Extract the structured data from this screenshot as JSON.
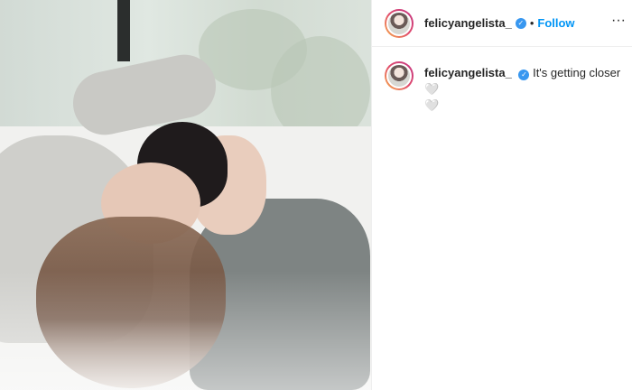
{
  "post": {
    "username": "felicyangelista_",
    "verified_glyph": "✓",
    "separator": "•",
    "follow_label": "Follow",
    "more_glyph": "···",
    "caption": "It's getting closer🤍",
    "caption_overflow": "🤍",
    "avatar_icon": "profile-avatar",
    "verified_icon": "verified-badge-icon",
    "colors": {
      "follow": "#0095f6",
      "verified": "#3897f0",
      "text": "#262626",
      "divider": "#efefef"
    }
  }
}
